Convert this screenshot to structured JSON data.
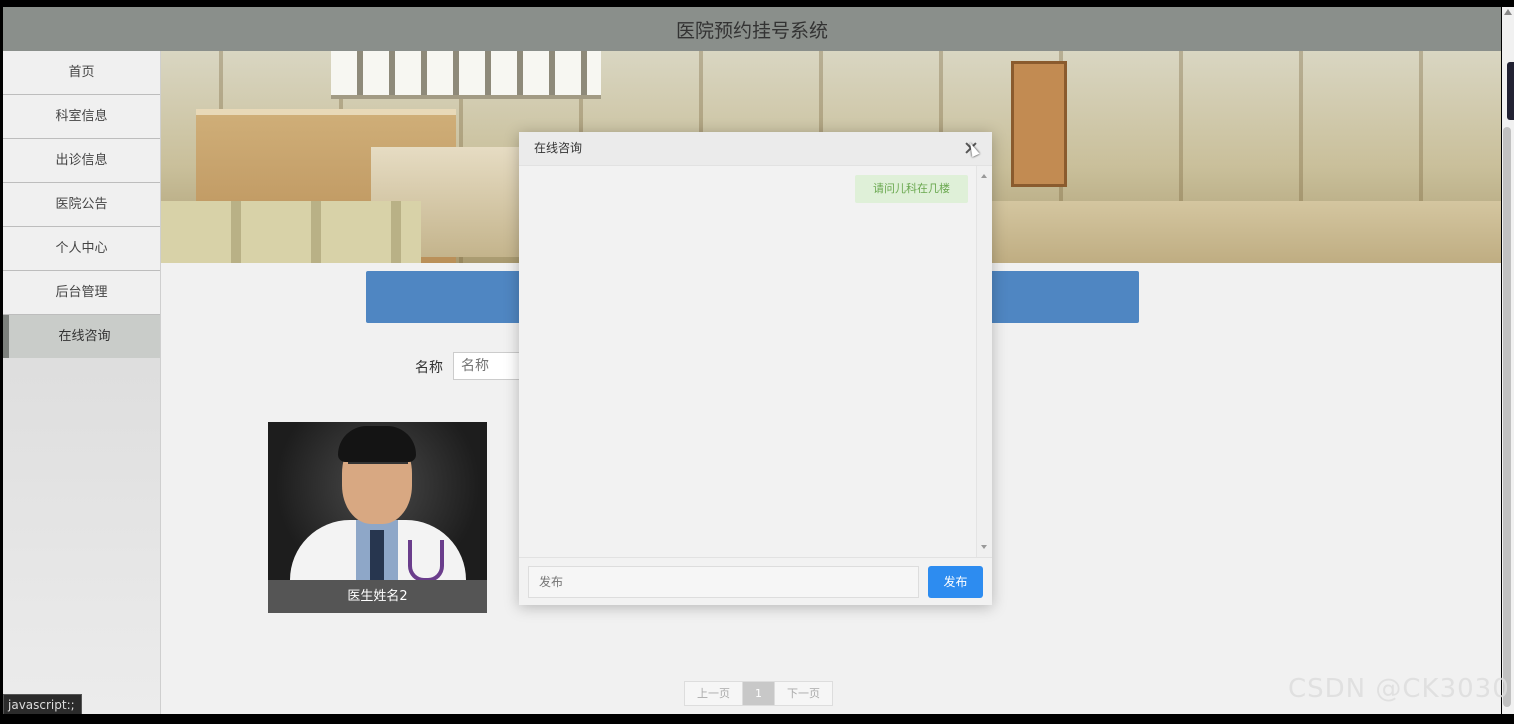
{
  "app": {
    "title": "医院预约挂号系统"
  },
  "sidebar": {
    "items": [
      {
        "label": "首页"
      },
      {
        "label": "科室信息"
      },
      {
        "label": "出诊信息"
      },
      {
        "label": "医院公告"
      },
      {
        "label": "个人中心"
      },
      {
        "label": "后台管理"
      },
      {
        "label": "在线咨询",
        "active": true
      }
    ]
  },
  "search": {
    "label": "名称",
    "placeholder": "名称"
  },
  "doctor_card": {
    "name": "医生姓名2"
  },
  "pagination": {
    "prev": "上一页",
    "current": "1",
    "next": "下一页"
  },
  "modal": {
    "title": "在线咨询",
    "messages": [
      {
        "text": "请问儿科在几楼"
      }
    ],
    "input_placeholder": "发布",
    "send_label": "发布"
  },
  "status_bar": {
    "url": "javascript:;"
  },
  "watermark": "CSDN @CK3030",
  "colors": {
    "accent_blue": "#2d8cf0",
    "banner_blue": "#4f86c2",
    "topbar": "#8a8f8b"
  }
}
